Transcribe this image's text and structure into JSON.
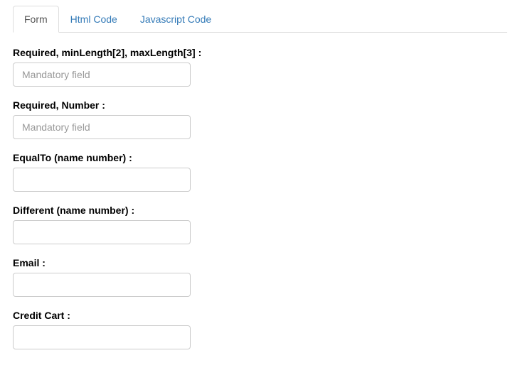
{
  "tabs": {
    "form": "Form",
    "html_code": "Html Code",
    "javascript_code": "Javascript Code"
  },
  "fields": {
    "required_minmax": {
      "label": "Required, minLength[2], maxLength[3] :",
      "placeholder": "Mandatory field",
      "value": ""
    },
    "required_number": {
      "label": "Required, Number :",
      "placeholder": "Mandatory field",
      "value": ""
    },
    "equal_to": {
      "label": "EqualTo (name number) :",
      "placeholder": "",
      "value": ""
    },
    "different": {
      "label": "Different (name number) :",
      "placeholder": "",
      "value": ""
    },
    "email": {
      "label": "Email :",
      "placeholder": "",
      "value": ""
    },
    "credit_cart": {
      "label": "Credit Cart :",
      "placeholder": "",
      "value": ""
    }
  }
}
